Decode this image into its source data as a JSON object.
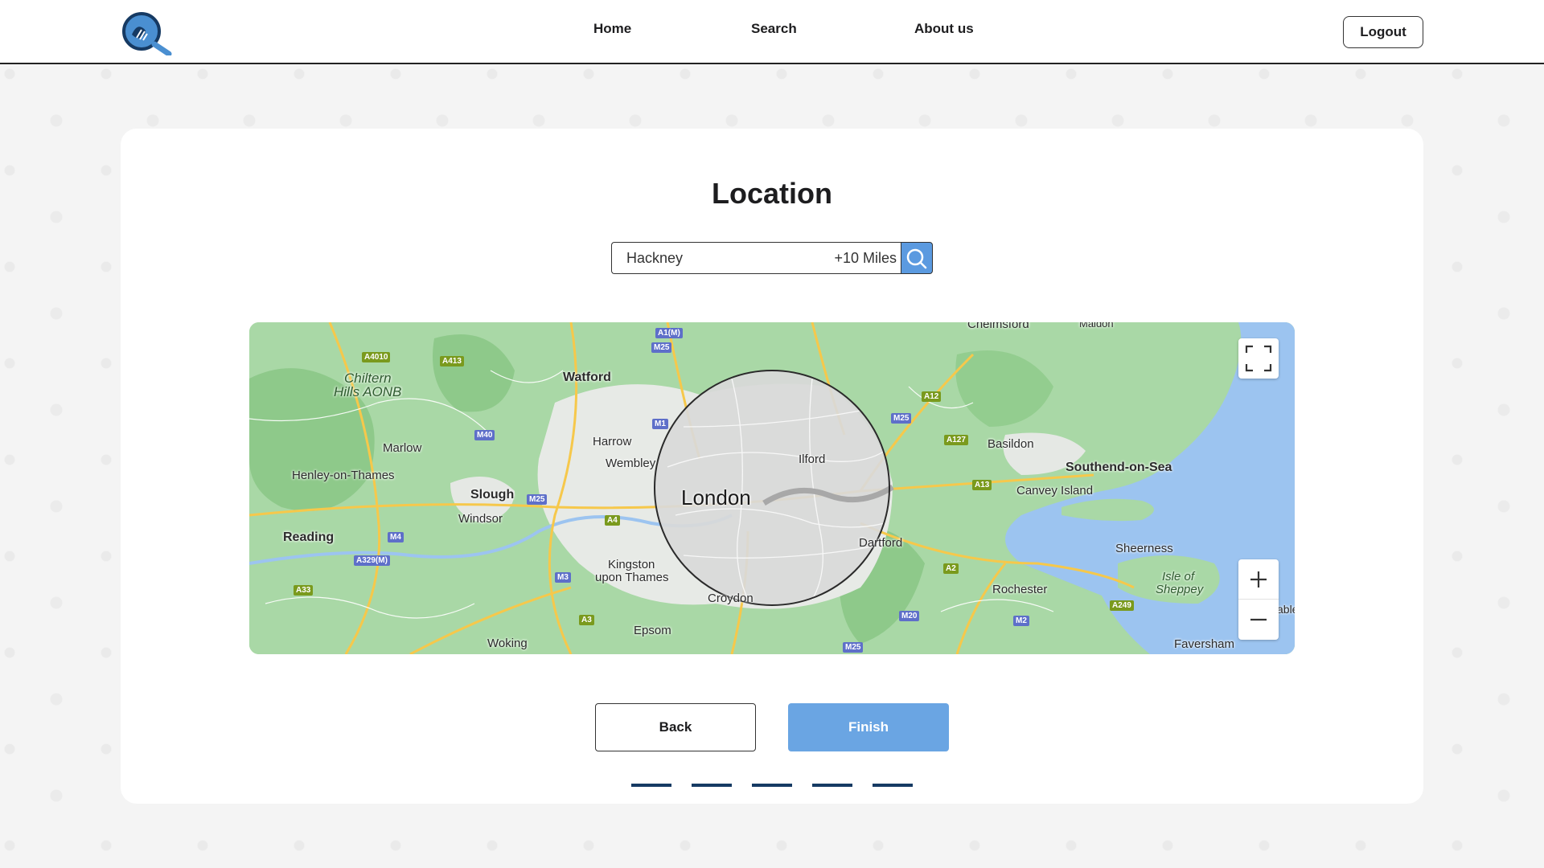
{
  "nav": {
    "home": "Home",
    "search": "Search",
    "about": "About us",
    "logout": "Logout"
  },
  "page": {
    "title": "Location"
  },
  "search": {
    "value": "Hackney",
    "radius": "+10 Miles"
  },
  "map": {
    "labels": {
      "chelmsford": "Chelmsford",
      "maldon": "Maldon",
      "watford": "Watford",
      "chiltern": "Chiltern",
      "hills_aonb": "Hills AONB",
      "marlow": "Marlow",
      "harrow": "Harrow",
      "wembley": "Wembley",
      "ilford": "Ilford",
      "basildon": "Basildon",
      "southend": "Southend-on-Sea",
      "canvey": "Canvey Island",
      "henley": "Henley-on-Thames",
      "slough": "Slough",
      "windsor": "Windsor",
      "london": "London",
      "dartford": "Dartford",
      "reading": "Reading",
      "sheerness": "Sheerness",
      "kingston_1": "Kingston",
      "kingston_2": "upon Thames",
      "isle_1": "Isle of",
      "isle_2": "Sheppey",
      "croydon": "Croydon",
      "rochester": "Rochester",
      "epsom": "Epsom",
      "woking": "Woking",
      "faversham": "Faversham",
      "able": "able"
    },
    "roads": {
      "a1m": "A1(M)",
      "m25_top": "M25",
      "a4010": "A4010",
      "a413": "A413",
      "m1": "M1",
      "m40": "M40",
      "a12": "A12",
      "m25_right": "M25",
      "a127": "A127",
      "a13": "A13",
      "m25_left": "M25",
      "a4": "A4",
      "m4": "M4",
      "a329m": "A329(M)",
      "m3": "M3",
      "a2": "A2",
      "a33": "A33",
      "a3": "A3",
      "m20": "M20",
      "m2": "M2",
      "a249": "A249",
      "m25_bottom": "M25"
    }
  },
  "buttons": {
    "back": "Back",
    "finish": "Finish"
  },
  "stepper": {
    "total_steps": 5
  },
  "colors": {
    "accent": "#6aa5e3",
    "search_button": "#5b9ae0",
    "step_indicator": "#163a63"
  }
}
